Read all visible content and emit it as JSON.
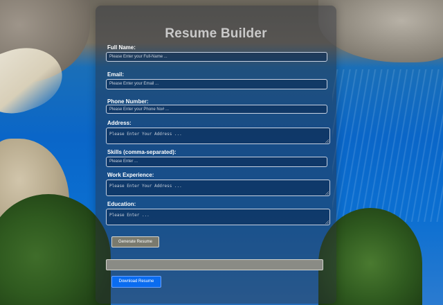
{
  "app": {
    "title": "Resume Builder"
  },
  "form": {
    "full_name": {
      "label": "Full Name:",
      "placeholder": "Please Enter your Full-Name ..."
    },
    "email": {
      "label": "Email:",
      "placeholder": "Please Enter your Email ..."
    },
    "phone": {
      "label": "Phone Number:",
      "placeholder": "Please Enter your Phone No# ..."
    },
    "address": {
      "label": "Address:",
      "placeholder": "Please Enter Your Address ..."
    },
    "skills": {
      "label": "Skills (comma-separated):",
      "placeholder": "Please Enter ..."
    },
    "work_experience": {
      "label": "Work Experience:",
      "placeholder": "Please Enter Your Address ..."
    },
    "education": {
      "label": "Education:",
      "placeholder": "Please Enter ..."
    }
  },
  "actions": {
    "generate_label": "Generate Resume",
    "download_label": "Download Resume"
  },
  "colors": {
    "download_button": "#0a6cf0",
    "generate_button": "#7a7a6e",
    "title_text": "#c9c9c9"
  }
}
